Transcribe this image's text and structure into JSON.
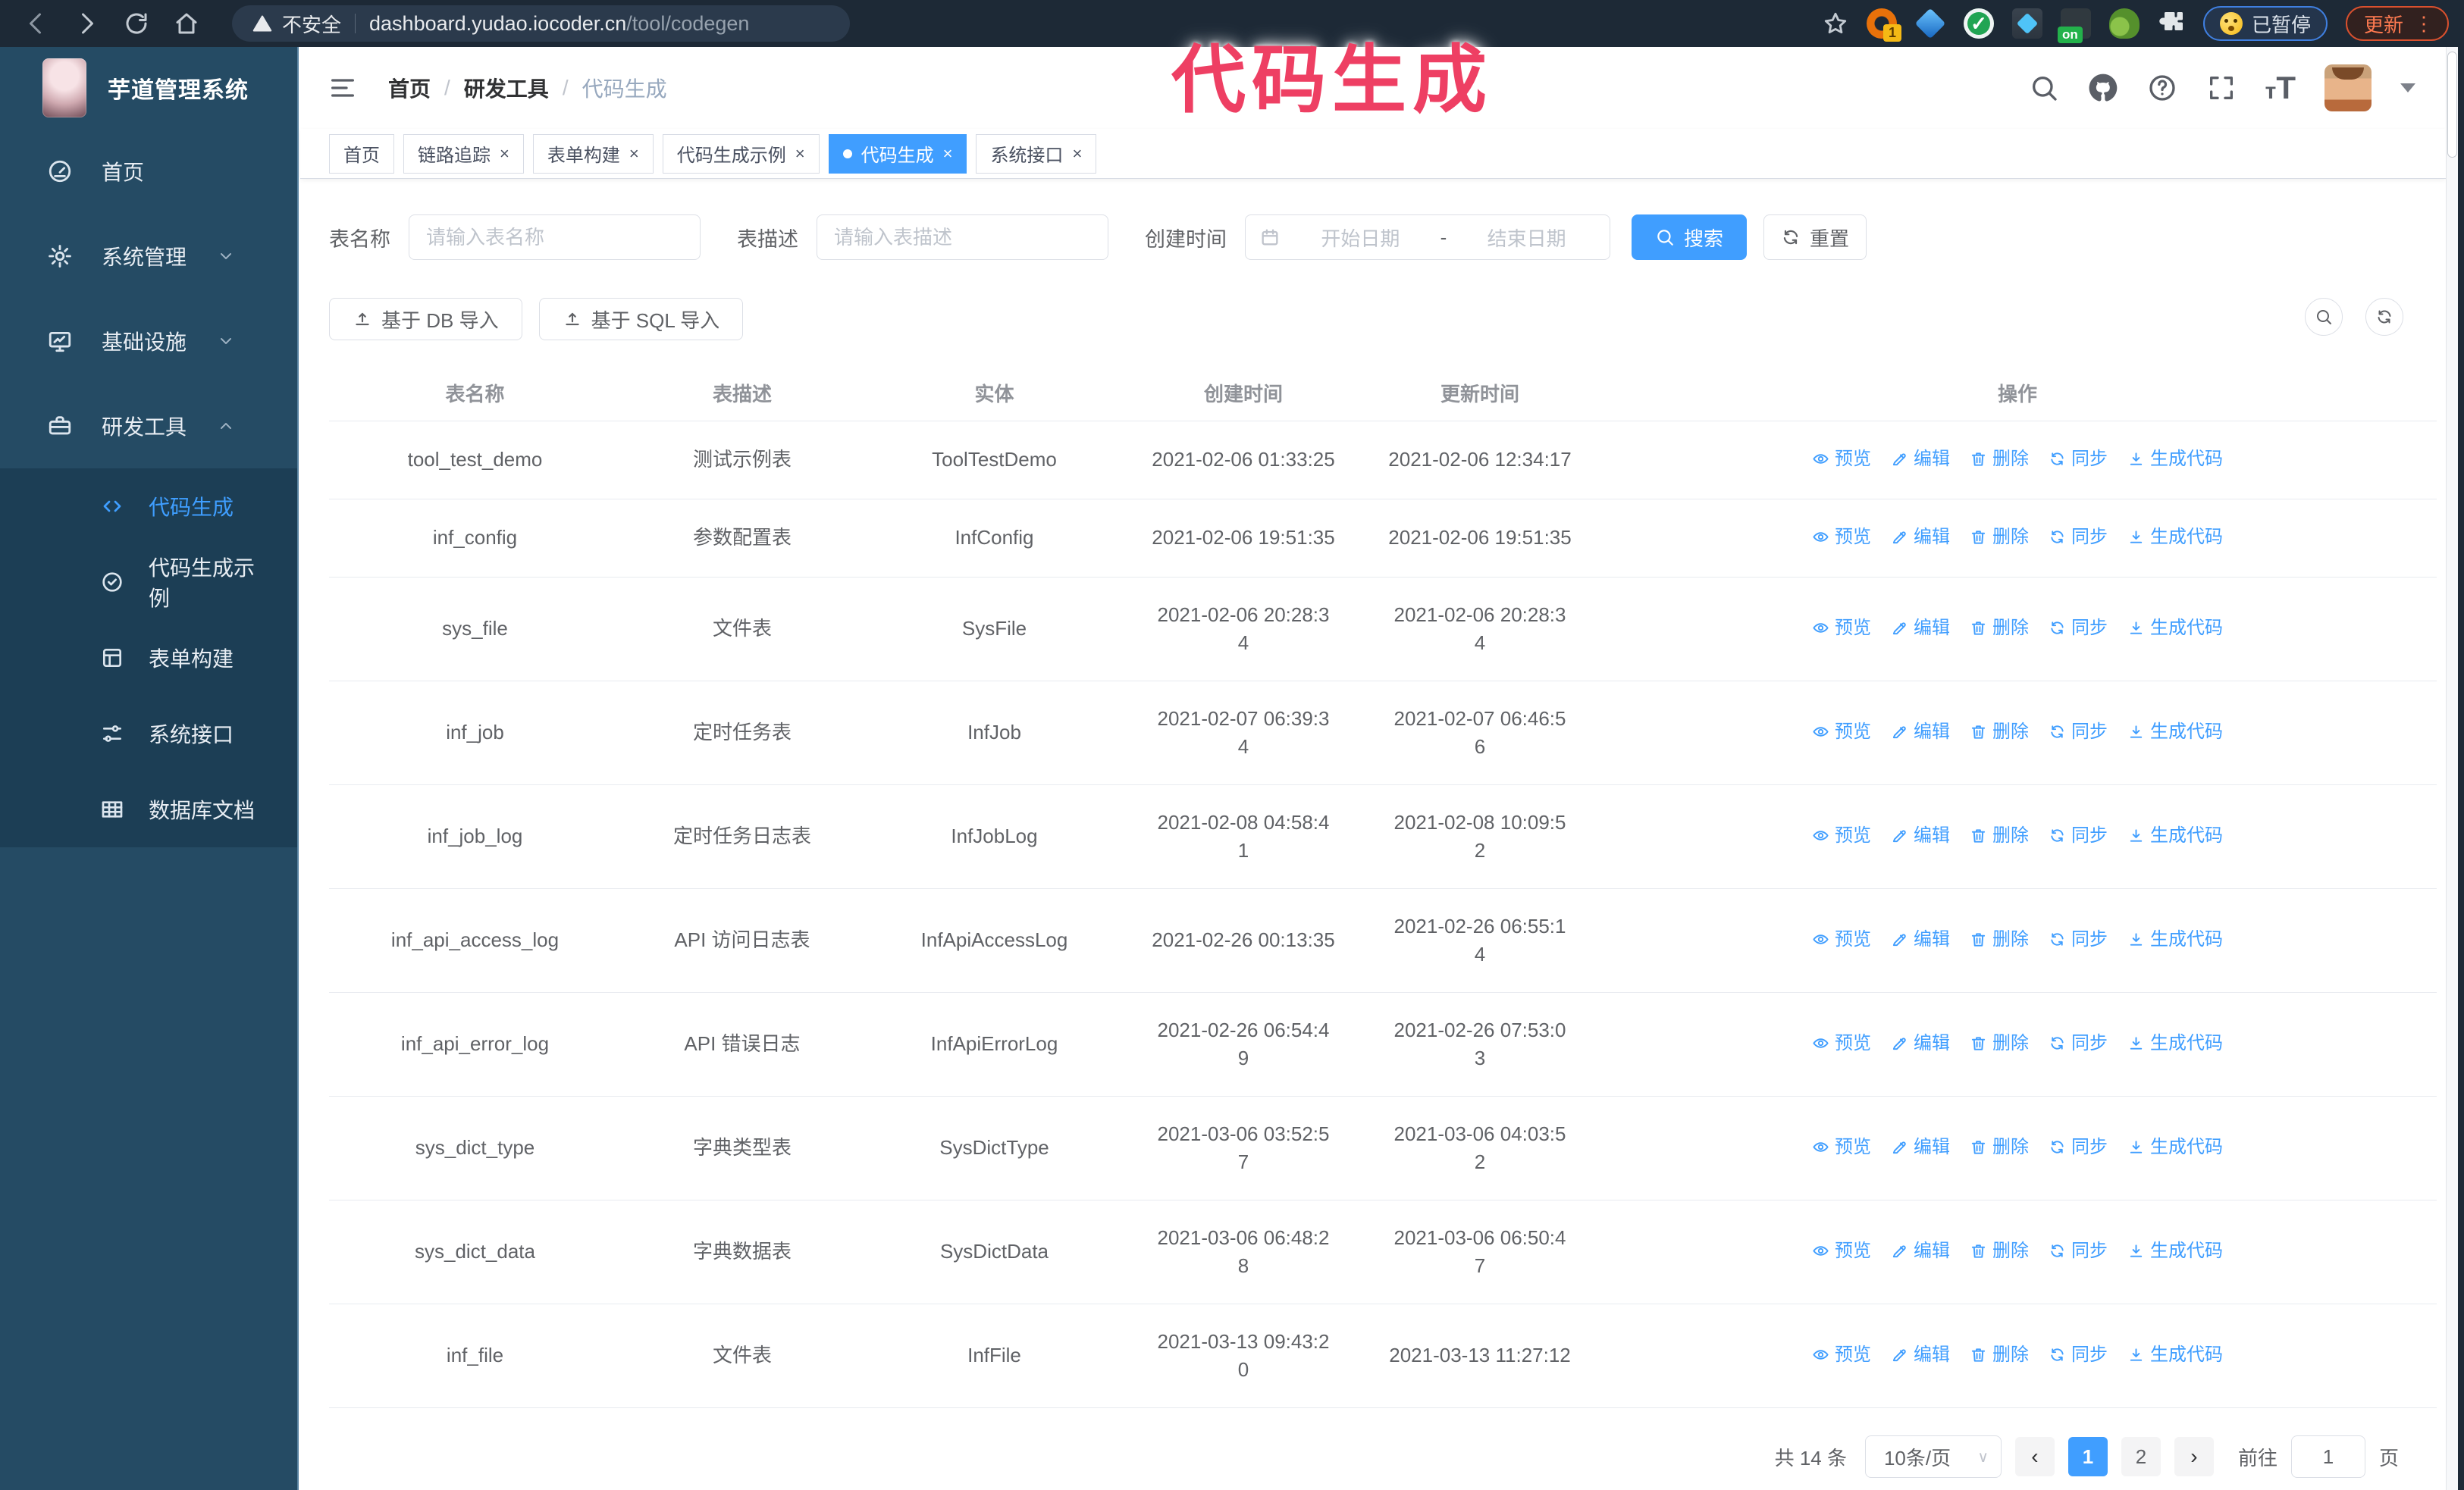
{
  "browser": {
    "security_label": "不安全",
    "url_host": "dashboard.yudao.iocoder.cn",
    "url_path": "/tool/codegen",
    "extension_badge": "1",
    "extension_on_badge": "on",
    "paused_badge": "已暂停",
    "update_label": "更新"
  },
  "annotation": {
    "text": "代码生成",
    "color": "#ee3f63"
  },
  "sidebar": {
    "logo_title": "芋道管理系统",
    "menu": [
      {
        "label": "首页",
        "icon": "dashboard"
      },
      {
        "label": "系统管理",
        "icon": "gear",
        "chevron": "down"
      },
      {
        "label": "基础设施",
        "icon": "monitor",
        "chevron": "down"
      },
      {
        "label": "研发工具",
        "icon": "toolbox",
        "chevron": "up"
      }
    ],
    "submenu": [
      {
        "label": "代码生成",
        "icon": "code",
        "active": true
      },
      {
        "label": "代码生成示例",
        "icon": "badge-check"
      },
      {
        "label": "表单构建",
        "icon": "form"
      },
      {
        "label": "系统接口",
        "icon": "sliders"
      },
      {
        "label": "数据库文档",
        "icon": "table-grid"
      }
    ]
  },
  "navbar": {
    "breadcrumb": [
      "首页",
      "研发工具",
      "代码生成"
    ]
  },
  "tabs": [
    {
      "label": "首页",
      "closable": false,
      "active": false
    },
    {
      "label": "链路追踪",
      "closable": true,
      "active": false
    },
    {
      "label": "表单构建",
      "closable": true,
      "active": false
    },
    {
      "label": "代码生成示例",
      "closable": true,
      "active": false
    },
    {
      "label": "代码生成",
      "closable": true,
      "active": true
    },
    {
      "label": "系统接口",
      "closable": true,
      "active": false
    }
  ],
  "filters": {
    "name_label": "表名称",
    "name_placeholder": "请输入表名称",
    "desc_label": "表描述",
    "desc_placeholder": "请输入表描述",
    "time_label": "创建时间",
    "start_placeholder": "开始日期",
    "range_separator": "-",
    "end_placeholder": "结束日期",
    "search_label": "搜索",
    "reset_label": "重置"
  },
  "toolbar": {
    "import_db_label": "基于 DB 导入",
    "import_sql_label": "基于 SQL 导入"
  },
  "table": {
    "columns": [
      "表名称",
      "表描述",
      "实体",
      "创建时间",
      "更新时间",
      "操作"
    ],
    "actions": [
      {
        "label": "预览",
        "icon": "eye"
      },
      {
        "label": "编辑",
        "icon": "edit"
      },
      {
        "label": "删除",
        "icon": "delete"
      },
      {
        "label": "同步",
        "icon": "sync"
      },
      {
        "label": "生成代码",
        "icon": "download"
      }
    ],
    "rows": [
      {
        "name": "tool_test_demo",
        "desc": "测试示例表",
        "entity": "ToolTestDemo",
        "created": "2021-02-06 01:33:25",
        "updated": "2021-02-06 12:34:17"
      },
      {
        "name": "inf_config",
        "desc": "参数配置表",
        "entity": "InfConfig",
        "created": "2021-02-06 19:51:35",
        "updated": "2021-02-06 19:51:35"
      },
      {
        "name": "sys_file",
        "desc": "文件表",
        "entity": "SysFile",
        "created": "2021-02-06 20:28:3\n4",
        "updated": "2021-02-06 20:28:3\n4"
      },
      {
        "name": "inf_job",
        "desc": "定时任务表",
        "entity": "InfJob",
        "created": "2021-02-07 06:39:3\n4",
        "updated": "2021-02-07 06:46:5\n6"
      },
      {
        "name": "inf_job_log",
        "desc": "定时任务日志表",
        "entity": "InfJobLog",
        "created": "2021-02-08 04:58:4\n1",
        "updated": "2021-02-08 10:09:5\n2"
      },
      {
        "name": "inf_api_access_log",
        "desc": "API 访问日志表",
        "entity": "InfApiAccessLog",
        "created": "2021-02-26 00:13:35",
        "updated": "2021-02-26 06:55:1\n4"
      },
      {
        "name": "inf_api_error_log",
        "desc": "API 错误日志",
        "entity": "InfApiErrorLog",
        "created": "2021-02-26 06:54:4\n9",
        "updated": "2021-02-26 07:53:0\n3"
      },
      {
        "name": "sys_dict_type",
        "desc": "字典类型表",
        "entity": "SysDictType",
        "created": "2021-03-06 03:52:5\n7",
        "updated": "2021-03-06 04:03:5\n2"
      },
      {
        "name": "sys_dict_data",
        "desc": "字典数据表",
        "entity": "SysDictData",
        "created": "2021-03-06 06:48:2\n8",
        "updated": "2021-03-06 06:50:4\n7"
      },
      {
        "name": "inf_file",
        "desc": "文件表",
        "entity": "InfFile",
        "created": "2021-03-13 09:43:2\n0",
        "updated": "2021-03-13 11:27:12"
      }
    ]
  },
  "pagination": {
    "total": "共 14 条",
    "page_size": "10条/页",
    "pages": [
      "1",
      "2"
    ],
    "active_page": "1",
    "jump_prefix": "前往",
    "jump_value": "1",
    "jump_suffix": "页"
  },
  "colors": {
    "accent": "#409EFF",
    "sidebar_bg": "#254b64",
    "submenu_bg": "#1c3e55",
    "annotation_pink": "#ee3f63"
  }
}
